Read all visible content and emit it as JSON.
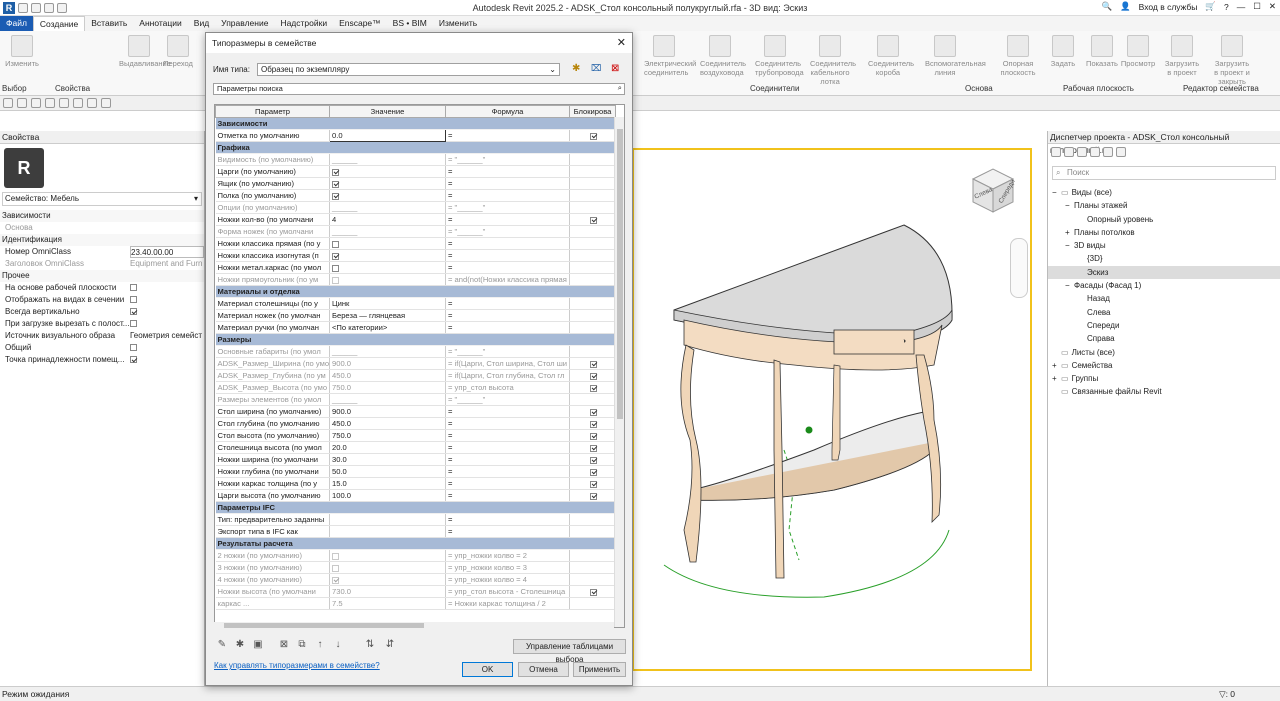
{
  "window": {
    "title": "Autodesk Revit 2025.2 - ADSK_Стол консольный полукруглый.rfa - 3D вид: Эскиз",
    "sign_in": "Вход в службы"
  },
  "tabs": [
    "Файл",
    "Создание",
    "Вставить",
    "Аннотации",
    "Вид",
    "Управление",
    "Надстройки",
    "Enscape™",
    "BS • BIM",
    "Изменить"
  ],
  "ribbon": {
    "buttons": [
      [
        "Изменить",
        2
      ],
      [
        "Выдавливание",
        119
      ],
      [
        "Переход",
        158
      ],
      [
        "Электрический соединитель",
        644
      ],
      [
        "Соединитель воздуховода",
        700
      ],
      [
        "Соединитель трубопровода",
        755
      ],
      [
        "Соединитель кабельного лотка",
        810
      ],
      [
        "Соединитель короба",
        868
      ],
      [
        "Вспомогательная линия",
        925
      ],
      [
        "Опорная плоскость",
        998
      ],
      [
        "Задать",
        1043
      ],
      [
        "Показать",
        1082
      ],
      [
        "Просмотр",
        1118
      ],
      [
        "Загрузить в проект",
        1162
      ],
      [
        "Загрузить в проект и закрыть",
        1212
      ]
    ],
    "groups": [
      [
        "Выбор",
        2
      ],
      [
        "Свойства",
        55
      ],
      [
        "Соединители",
        750
      ],
      [
        "Основа",
        965
      ],
      [
        "Рабочая плоскость",
        1063
      ],
      [
        "Редактор семейства",
        1183
      ]
    ]
  },
  "properties": {
    "header": "Свойства",
    "family": "Семейство: Мебель",
    "rows": [
      {
        "k": "Зависимости",
        "v": "",
        "type": "hdr"
      },
      {
        "k": "Основа",
        "v": "",
        "type": "grey"
      },
      {
        "k": "Идентификация",
        "v": "",
        "type": "hdr"
      },
      {
        "k": "Номер OmniClass",
        "v": "23.40.00.00",
        "type": "val"
      },
      {
        "k": "Заголовок OmniClass",
        "v": "Equipment and Furn",
        "type": "grey"
      },
      {
        "k": "Прочее",
        "v": "",
        "type": "hdr"
      },
      {
        "k": "На основе рабочей плоскости",
        "v": "",
        "type": "cb0"
      },
      {
        "k": "Отображать на видах в сечении",
        "v": "",
        "type": "cb0"
      },
      {
        "k": "Всегда вертикально",
        "v": "",
        "type": "cb1"
      },
      {
        "k": "При загрузке вырезать с полост...",
        "v": "",
        "type": "cb0"
      },
      {
        "k": "Источник визуального образа",
        "v": "Геометрия семейст",
        "type": "val"
      },
      {
        "k": "Общий",
        "v": "",
        "type": "cb0"
      },
      {
        "k": "Точка принадлежности помещ...",
        "v": "",
        "type": "cb1"
      }
    ]
  },
  "dialog": {
    "title": "Типоразмеры в семействе",
    "type_name_label": "Имя типа:",
    "type_name_value": "Образец по экземпляру",
    "search_placeholder": "Параметры поиска",
    "columns": [
      "Параметр",
      "Значение",
      "Формула",
      "Блокирова"
    ],
    "rows": [
      {
        "g": "Зависимости"
      },
      {
        "p": "Отметка по умолчанию",
        "v": "0.0",
        "f": "=",
        "l": 1,
        "sel": 1
      },
      {
        "g": "Графика"
      },
      {
        "p": "Видимость (по умолчанию)",
        "v": "______",
        "f": "= \"______\"",
        "d": 1
      },
      {
        "p": "Царги (по умолчанию)",
        "cb": 1,
        "f": "="
      },
      {
        "p": "Ящик (по умолчанию)",
        "cb": 1,
        "f": "="
      },
      {
        "p": "Полка (по умолчанию)",
        "cb": 1,
        "f": "="
      },
      {
        "p": "Опции (по умолчанию)",
        "v": "______",
        "f": "= \"______\"",
        "d": 1
      },
      {
        "p": "Ножки кол-во (по умолчани",
        "v": "4",
        "f": "=",
        "l": 1
      },
      {
        "p": "Форма ножек (по умолчани",
        "v": "______",
        "f": "= \"______\"",
        "d": 1
      },
      {
        "p": "Ножки классика прямая (по у",
        "cb": 0,
        "f": "="
      },
      {
        "p": "Ножки классика изогнутая (п",
        "cb": 1,
        "f": "="
      },
      {
        "p": "Ножки метал.каркас (по умол",
        "cb": 0,
        "f": "="
      },
      {
        "p": "Ножки прямоугольник (по ум",
        "cb": 0,
        "f": "= and(not(Ножки классика прямая",
        "d": 1
      },
      {
        "g": "Материалы и отделка"
      },
      {
        "p": "Материал столешницы (по у",
        "v": "Цинк",
        "f": "="
      },
      {
        "p": "Материал ножек (по умолчан",
        "v": "Береза — глянцевая",
        "f": "="
      },
      {
        "p": "Материал ручки (по умолчан",
        "v": "<По категории>",
        "f": "="
      },
      {
        "g": "Размеры"
      },
      {
        "p": "Основные габариты (по умол",
        "v": "______",
        "f": "= \"______\"",
        "d": 1
      },
      {
        "p": "ADSK_Размер_Ширина (по умо",
        "v": "900.0",
        "f": "= if(Царги, Стол ширина, Стол ши",
        "l": 1,
        "d": 1
      },
      {
        "p": "ADSK_Размер_Глубина (по ум",
        "v": "450.0",
        "f": "= if(Царги, Стол глубина, Стол гл",
        "l": 1,
        "d": 1
      },
      {
        "p": "ADSK_Размер_Высота (по умо",
        "v": "750.0",
        "f": "= упр_стол высота",
        "l": 1,
        "d": 1
      },
      {
        "p": "Размеры элементов (по умол",
        "v": "______",
        "f": "= \"______\"",
        "d": 1
      },
      {
        "p": "Стол ширина (по умолчанию)",
        "v": "900.0",
        "f": "=",
        "l": 1
      },
      {
        "p": "Стол глубина (по умолчанию",
        "v": "450.0",
        "f": "=",
        "l": 1
      },
      {
        "p": "Стол высота (по умолчанию)",
        "v": "750.0",
        "f": "=",
        "l": 1
      },
      {
        "p": "Столешница высота (по умол",
        "v": "20.0",
        "f": "=",
        "l": 1
      },
      {
        "p": "Ножки ширина (по умолчани",
        "v": "30.0",
        "f": "=",
        "l": 1
      },
      {
        "p": "Ножки глубина (по умолчани",
        "v": "50.0",
        "f": "=",
        "l": 1
      },
      {
        "p": "Ножки каркас толщина (по у",
        "v": "15.0",
        "f": "=",
        "l": 1
      },
      {
        "p": "Царги высота (по умолчанию",
        "v": "100.0",
        "f": "=",
        "l": 1
      },
      {
        "g": "Параметры IFC"
      },
      {
        "p": "Тип: предварительно заданны",
        "v": "",
        "f": "="
      },
      {
        "p": "Экспорт типа в IFC как",
        "v": "",
        "f": "="
      },
      {
        "g": "Результаты расчета"
      },
      {
        "p": "2 ножки (по умолчанию)",
        "cb": 0,
        "f": "= упр_ножки колво = 2",
        "d": 1
      },
      {
        "p": "3 ножки (по умолчанию)",
        "cb": 0,
        "f": "= упр_ножки колво = 3",
        "d": 1
      },
      {
        "p": "4 ножки (по умолчанию)",
        "cb": 1,
        "f": "= упр_ножки колво = 4",
        "d": 1
      },
      {
        "p": "Ножки высота (по умолчани",
        "v": "730.0",
        "f": "= упр_стол высота - Столешница",
        "l": 1,
        "d": 1
      },
      {
        "p": "каркас ...",
        "v": "7.5",
        "f": "= Ножки каркас толщина / 2",
        "d": 1
      }
    ],
    "manage_lookup": "Управление таблицами выбора",
    "help_link": "Как управлять типоразмерами в семействе?",
    "ok": "OK",
    "cancel": "Отмена",
    "apply": "Применить"
  },
  "project_browser": {
    "title": "Диспетчер проекта - ADSK_Стол консольный полукруглый.rfa",
    "search_placeholder": "Поиск",
    "nodes": [
      {
        "t": "Виды (все)",
        "lvl": 0,
        "tg": "−"
      },
      {
        "t": "Планы этажей",
        "lvl": 1,
        "tg": "−"
      },
      {
        "t": "Опорный уровень",
        "lvl": 2,
        "tg": ""
      },
      {
        "t": "Планы потолков",
        "lvl": 1,
        "tg": "+"
      },
      {
        "t": "3D виды",
        "lvl": 1,
        "tg": "−"
      },
      {
        "t": "{3D}",
        "lvl": 2,
        "tg": ""
      },
      {
        "t": "Эскиз",
        "lvl": 2,
        "tg": "",
        "sel": 1
      },
      {
        "t": "Фасады (Фасад 1)",
        "lvl": 1,
        "tg": "−"
      },
      {
        "t": "Назад",
        "lvl": 2,
        "tg": ""
      },
      {
        "t": "Слева",
        "lvl": 2,
        "tg": ""
      },
      {
        "t": "Спереди",
        "lvl": 2,
        "tg": ""
      },
      {
        "t": "Справа",
        "lvl": 2,
        "tg": ""
      },
      {
        "t": "Листы (все)",
        "lvl": 0,
        "tg": ""
      },
      {
        "t": "Семейства",
        "lvl": 0,
        "tg": "+"
      },
      {
        "t": "Группы",
        "lvl": 0,
        "tg": "+"
      },
      {
        "t": "Связанные файлы Revit",
        "lvl": 0,
        "tg": ""
      }
    ]
  },
  "viewcube": {
    "left": "Слева",
    "front": "Спереди"
  },
  "status": {
    "text": "Режим ожидания",
    "filter_count": "0"
  }
}
